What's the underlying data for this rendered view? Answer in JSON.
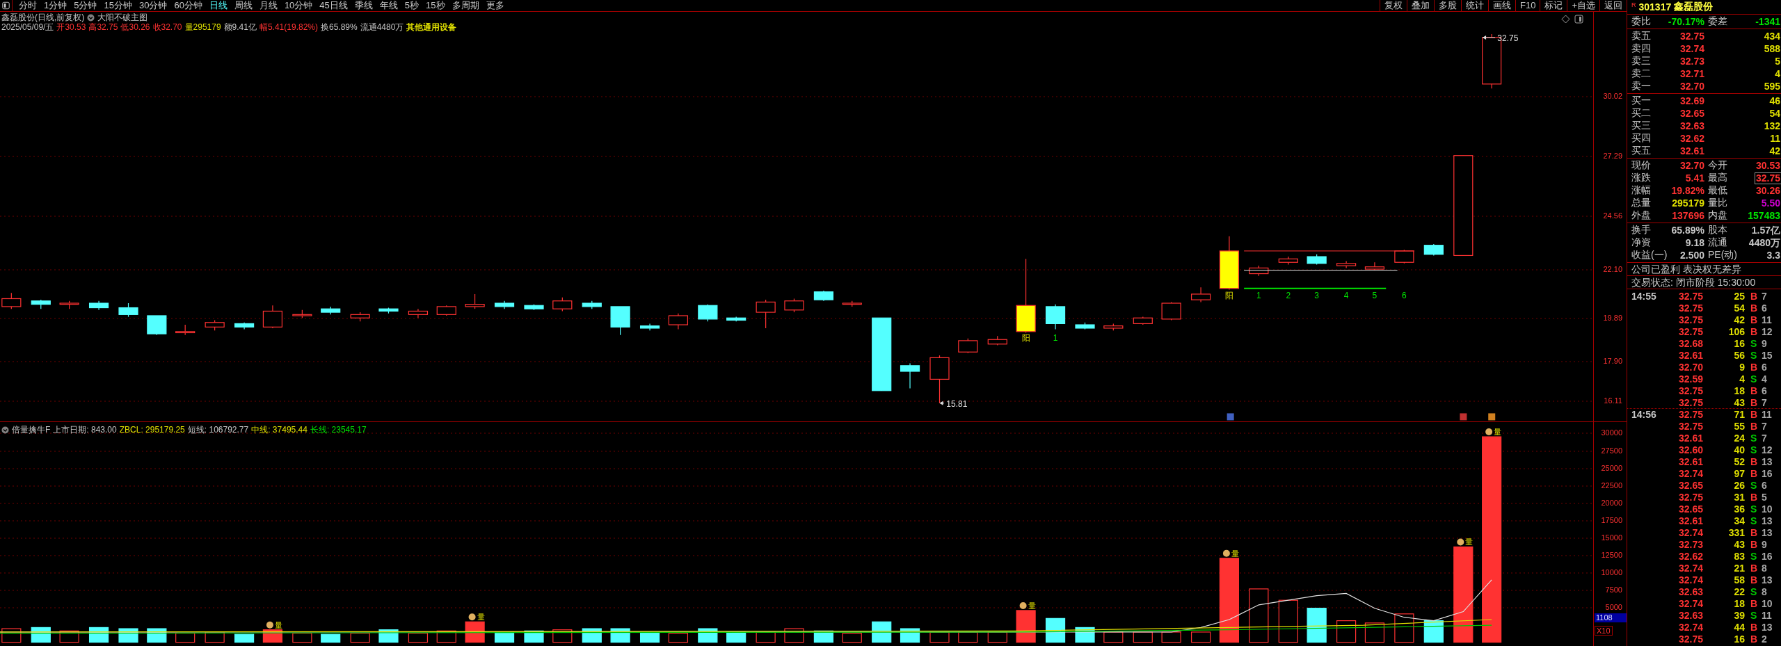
{
  "toolbar": {
    "tabs": [
      {
        "label": "分时",
        "selected": false
      },
      {
        "label": "1分钟",
        "selected": false
      },
      {
        "label": "5分钟",
        "selected": false
      },
      {
        "label": "15分钟",
        "selected": false
      },
      {
        "label": "30分钟",
        "selected": false
      },
      {
        "label": "60分钟",
        "selected": false
      },
      {
        "label": "日线",
        "selected": true
      },
      {
        "label": "周线",
        "selected": false
      },
      {
        "label": "月线",
        "selected": false
      },
      {
        "label": "10分钟",
        "selected": false
      },
      {
        "label": "45日线",
        "selected": false
      },
      {
        "label": "季线",
        "selected": false
      },
      {
        "label": "年线",
        "selected": false
      },
      {
        "label": "5秒",
        "selected": false
      },
      {
        "label": "15秒",
        "selected": false
      },
      {
        "label": "多周期",
        "selected": false
      },
      {
        "label": "更多",
        "selected": false
      }
    ],
    "buttons": [
      "复权",
      "叠加",
      "多股",
      "统计",
      "画线",
      "F10",
      "标记",
      "+自选",
      "返回"
    ]
  },
  "main_chart": {
    "title": "鑫磊股份(日线,前复权)",
    "indicator": "大阳不破主图",
    "quote_line": [
      {
        "text": "2025/05/09/五",
        "color": "#c8c8c8"
      },
      {
        "text": "开30.53",
        "color": "#ff3232"
      },
      {
        "text": "高32.75",
        "color": "#ff3232"
      },
      {
        "text": "低30.26",
        "color": "#ff3232"
      },
      {
        "text": "收32.70",
        "color": "#ff3232"
      },
      {
        "text": "量295179",
        "color": "#e0e000"
      },
      {
        "text": "额9.41亿",
        "color": "#c8c8c8"
      },
      {
        "text": "幅5.41(19.82%)",
        "color": "#ff3232"
      },
      {
        "text": "换65.89%",
        "color": "#c8c8c8"
      },
      {
        "text": "流通4480万",
        "color": "#c8c8c8"
      },
      {
        "text": "其他通用设备",
        "color": "#e0e000"
      }
    ],
    "annotations": [
      "32.75",
      "15.81",
      "阳",
      "1",
      "阳",
      "1",
      "2",
      "3",
      "4",
      "5",
      "6"
    ],
    "price_axis": [
      "30.02",
      "27.29",
      "24.56",
      "22.10",
      "19.89",
      "17.90",
      "16.11"
    ]
  },
  "volume_chart": {
    "indicator": "倍量擒牛F",
    "values": [
      {
        "text": "上市日期: 843.00",
        "color": "#c8c8c8"
      },
      {
        "text": "ZBCL: 295179.25",
        "color": "#e0e000"
      },
      {
        "text": "短线: 106792.77",
        "color": "#c8c8c8"
      },
      {
        "text": "中线: 37495.44",
        "color": "#e0e000"
      },
      {
        "text": "长线: 23545.17",
        "color": "#00e600"
      }
    ],
    "marks": [
      "量",
      "量",
      "量",
      "量",
      "量",
      "量"
    ],
    "volume_axis": [
      "30000",
      "27500",
      "25000",
      "22500",
      "20000",
      "17500",
      "15000",
      "12500",
      "10000",
      "7500",
      "5000"
    ],
    "readout": "1108",
    "scale": "X10"
  },
  "quote_panel": {
    "badge": "R",
    "code": "301317",
    "name": "鑫磊股份",
    "ratio": [
      {
        "label": "委比",
        "value": "-70.17%",
        "color": "#00e600",
        "boxed": false
      },
      {
        "label": "委差",
        "value": "-1341",
        "color": "#00e600",
        "boxed": false
      }
    ],
    "asks": [
      {
        "label": "卖五",
        "price": "32.75",
        "volume": "434"
      },
      {
        "label": "卖四",
        "price": "32.74",
        "volume": "588"
      },
      {
        "label": "卖三",
        "price": "32.73",
        "volume": "5"
      },
      {
        "label": "卖二",
        "price": "32.71",
        "volume": "4"
      },
      {
        "label": "卖一",
        "price": "32.70",
        "volume": "595"
      }
    ],
    "bids": [
      {
        "label": "买一",
        "price": "32.69",
        "volume": "46"
      },
      {
        "label": "买二",
        "price": "32.65",
        "volume": "54"
      },
      {
        "label": "买三",
        "price": "32.63",
        "volume": "132"
      },
      {
        "label": "买四",
        "price": "32.62",
        "volume": "11"
      },
      {
        "label": "买五",
        "price": "32.61",
        "volume": "42"
      }
    ],
    "stats": [
      {
        "label": "现价",
        "value": "32.70",
        "color": "#ff3232",
        "boxed": false
      },
      {
        "label": "今开",
        "value": "30.53",
        "color": "#ff3232",
        "boxed": false
      },
      {
        "label": "涨跌",
        "value": "5.41",
        "color": "#ff3232",
        "boxed": false
      },
      {
        "label": "最高",
        "value": "32.75",
        "color": "#ff3232",
        "boxed": true
      },
      {
        "label": "涨幅",
        "value": "19.82%",
        "color": "#ff3232",
        "boxed": false
      },
      {
        "label": "最低",
        "value": "30.26",
        "color": "#ff3232",
        "boxed": false
      },
      {
        "label": "总量",
        "value": "295179",
        "color": "#e0e000",
        "boxed": false
      },
      {
        "label": "量比",
        "value": "5.50",
        "color": "#d000d0",
        "boxed": false
      },
      {
        "label": "外盘",
        "value": "137696",
        "color": "#ff3232",
        "boxed": false
      },
      {
        "label": "内盘",
        "value": "157483",
        "color": "#00e600",
        "boxed": false
      }
    ],
    "fundamentals": [
      {
        "label": "换手",
        "value": "65.89%",
        "color": "#c8c8c8",
        "boxed": false
      },
      {
        "label": "股本",
        "value": "1.57亿",
        "color": "#c8c8c8",
        "boxed": false
      },
      {
        "label": "净资",
        "value": "9.18",
        "color": "#c8c8c8",
        "boxed": false
      },
      {
        "label": "流通",
        "value": "4480万",
        "color": "#c8c8c8",
        "boxed": false
      },
      {
        "label": "收益(一)",
        "value": "2.500",
        "color": "#c8c8c8",
        "boxed": false
      },
      {
        "label": "PE(动)",
        "value": "3.3",
        "color": "#c8c8c8",
        "boxed": false
      }
    ],
    "notice": "公司已盈利 表决权无差异",
    "status": "交易状态: 闭市阶段 15:30:00",
    "trades": [
      {
        "time": "14:55",
        "rows": [
          {
            "price": "32.75",
            "volume": "25",
            "side": "B",
            "color": "#ff3232",
            "count": "7"
          },
          {
            "price": "32.75",
            "volume": "54",
            "side": "B",
            "color": "#ff3232",
            "count": "6"
          },
          {
            "price": "32.75",
            "volume": "42",
            "side": "B",
            "color": "#ff3232",
            "count": "11"
          },
          {
            "price": "32.75",
            "volume": "106",
            "side": "B",
            "color": "#ff3232",
            "count": "12"
          },
          {
            "price": "32.68",
            "volume": "16",
            "side": "S",
            "color": "#00c800",
            "count": "9"
          },
          {
            "price": "32.61",
            "volume": "56",
            "side": "S",
            "color": "#00c800",
            "count": "15"
          },
          {
            "price": "32.70",
            "volume": "9",
            "side": "B",
            "color": "#ff3232",
            "count": "6"
          },
          {
            "price": "32.59",
            "volume": "4",
            "side": "S",
            "color": "#00c800",
            "count": "4"
          },
          {
            "price": "32.75",
            "volume": "18",
            "side": "B",
            "color": "#ff3232",
            "count": "6"
          },
          {
            "price": "32.75",
            "volume": "43",
            "side": "B",
            "color": "#ff3232",
            "count": "7"
          }
        ]
      },
      {
        "time": "14:56",
        "rows": [
          {
            "price": "32.75",
            "volume": "71",
            "side": "B",
            "color": "#ff3232",
            "count": "11"
          },
          {
            "price": "32.75",
            "volume": "55",
            "side": "B",
            "color": "#ff3232",
            "count": "7"
          },
          {
            "price": "32.61",
            "volume": "24",
            "side": "S",
            "color": "#00c800",
            "count": "7"
          },
          {
            "price": "32.60",
            "volume": "40",
            "side": "S",
            "color": "#00c800",
            "count": "12"
          },
          {
            "price": "32.61",
            "volume": "52",
            "side": "B",
            "color": "#ff3232",
            "count": "13"
          },
          {
            "price": "32.74",
            "volume": "97",
            "side": "B",
            "color": "#ff3232",
            "count": "16"
          },
          {
            "price": "32.65",
            "volume": "26",
            "side": "S",
            "color": "#00c800",
            "count": "6"
          },
          {
            "price": "32.75",
            "volume": "31",
            "side": "B",
            "color": "#ff3232",
            "count": "5"
          },
          {
            "price": "32.65",
            "volume": "36",
            "side": "S",
            "color": "#00c800",
            "count": "10"
          },
          {
            "price": "32.61",
            "volume": "34",
            "side": "S",
            "color": "#00c800",
            "count": "13"
          },
          {
            "price": "32.74",
            "volume": "331",
            "side": "B",
            "color": "#ff3232",
            "count": "13"
          },
          {
            "price": "32.73",
            "volume": "43",
            "side": "B",
            "color": "#ff3232",
            "count": "9"
          },
          {
            "price": "32.62",
            "volume": "83",
            "side": "S",
            "color": "#00c800",
            "count": "16"
          },
          {
            "price": "32.74",
            "volume": "21",
            "side": "B",
            "color": "#ff3232",
            "count": "8"
          },
          {
            "price": "32.74",
            "volume": "58",
            "side": "B",
            "color": "#ff3232",
            "count": "13"
          },
          {
            "price": "32.63",
            "volume": "22",
            "side": "S",
            "color": "#00c800",
            "count": "8"
          },
          {
            "price": "32.74",
            "volume": "18",
            "side": "B",
            "color": "#ff3232",
            "count": "10"
          },
          {
            "price": "32.63",
            "volume": "39",
            "side": "S",
            "color": "#00c800",
            "count": "11"
          },
          {
            "price": "32.74",
            "volume": "44",
            "side": "B",
            "color": "#ff3232",
            "count": "13"
          },
          {
            "price": "32.75",
            "volume": "16",
            "side": "B",
            "color": "#ff3232",
            "count": "2"
          }
        ]
      }
    ]
  }
}
